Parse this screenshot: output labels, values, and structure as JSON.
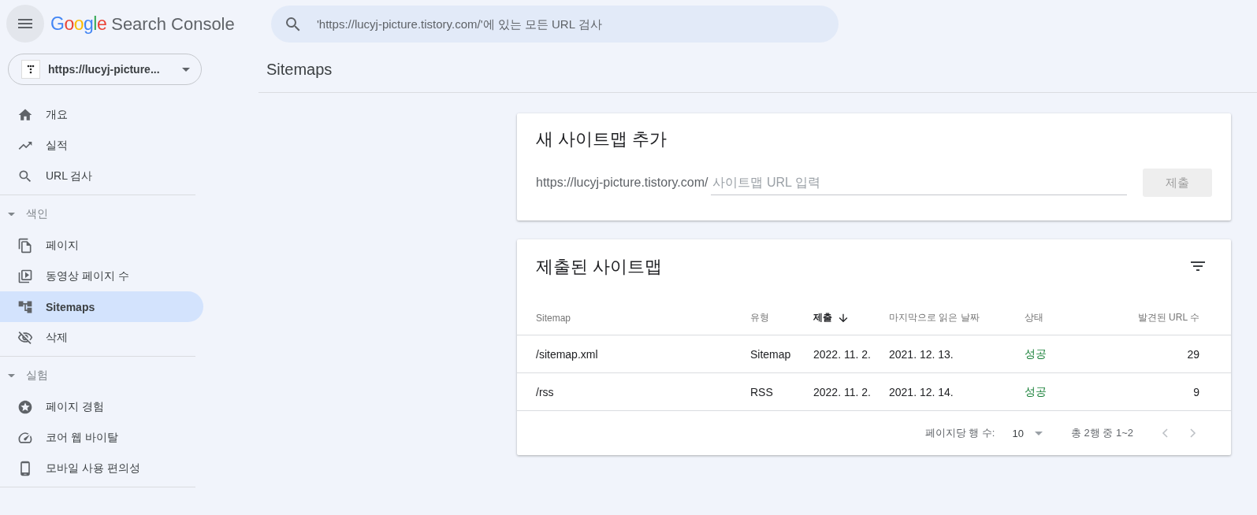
{
  "header": {
    "logo": "Google",
    "product": "Search Console",
    "search": {
      "placeholder": "'https://lucyj-picture.tistory.com/'에 있는 모든 URL 검사"
    }
  },
  "property": {
    "label": "https://lucyj-picture..."
  },
  "sidebar": {
    "groups": [
      {
        "items": [
          {
            "label": "개요",
            "selected": false
          },
          {
            "label": "실적",
            "selected": false
          },
          {
            "label": "URL 검사",
            "selected": false
          }
        ]
      },
      {
        "title": "색인",
        "expanded": true,
        "items": [
          {
            "label": "페이지",
            "selected": false
          },
          {
            "label": "동영상 페이지 수",
            "selected": false
          },
          {
            "label": "Sitemaps",
            "selected": true
          },
          {
            "label": "삭제",
            "selected": false
          }
        ]
      },
      {
        "title": "실험",
        "expanded": true,
        "items": [
          {
            "label": "페이지 경험",
            "selected": false
          },
          {
            "label": "코어 웹 바이탈",
            "selected": false
          },
          {
            "label": "모바일 사용 편의성",
            "selected": false
          }
        ]
      }
    ]
  },
  "page_title": "Sitemaps",
  "add_card": {
    "title": "새 사이트맵 추가",
    "prefix": "https://lucyj-picture.tistory.com/",
    "placeholder": "사이트맵 URL 입력",
    "button": {
      "label": "제출",
      "disabled": true
    }
  },
  "table_card": {
    "title": "제출된 사이트맵",
    "columns": [
      {
        "label": "Sitemap",
        "sorted": false
      },
      {
        "label": "유형",
        "sorted": false
      },
      {
        "label": "제출",
        "sorted": true
      },
      {
        "label": "마지막으로 읽은 날짜",
        "sorted": false
      },
      {
        "label": "상태",
        "sorted": false
      },
      {
        "label": "발견된 URL 수",
        "sorted": false
      }
    ],
    "rows": [
      [
        "/sitemap.xml",
        "Sitemap",
        "2022. 11. 2.",
        "2021. 12. 13.",
        "성공",
        "29"
      ],
      [
        "/rss",
        "RSS",
        "2022. 11. 2.",
        "2021. 12. 14.",
        "성공",
        "9"
      ]
    ],
    "pagination": {
      "rows_label": "페이지당 행 수:",
      "rows_value": "10",
      "range": "총 2행 중 1~2"
    }
  }
}
